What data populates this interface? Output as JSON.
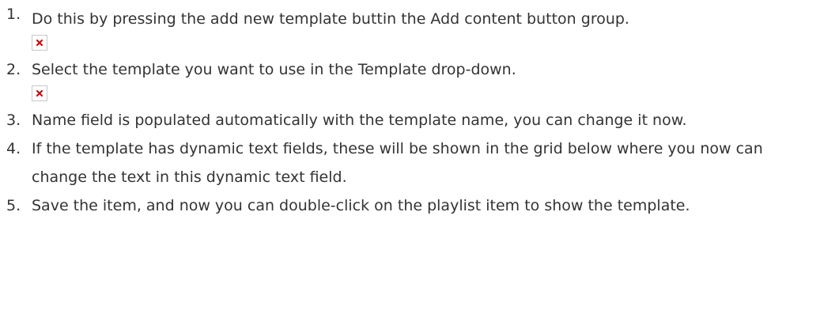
{
  "colors": {
    "text": "#333333",
    "broken_image_x": "#cc0000",
    "broken_image_border": "#c8c8c8"
  },
  "steps": [
    {
      "number": "1.",
      "text": "Do this by pressing the add new template buttin the Add content button group.",
      "has_image": true,
      "image_icon": "broken-image-icon"
    },
    {
      "number": "2.",
      "text": "Select the template you want to use in the Template drop-down.",
      "has_image": true,
      "image_icon": "broken-image-icon"
    },
    {
      "number": "3.",
      "text": "Name field is populated automatically with the template name, you can change it now.",
      "has_image": false
    },
    {
      "number": "4.",
      "text": "If the template has dynamic text fields, these will be shown in the grid below where you now can change the text in this dynamic text field.",
      "has_image": false
    },
    {
      "number": "5.",
      "text": "Save the item, and now you can double-click on the playlist item to show the template.",
      "has_image": false
    }
  ]
}
